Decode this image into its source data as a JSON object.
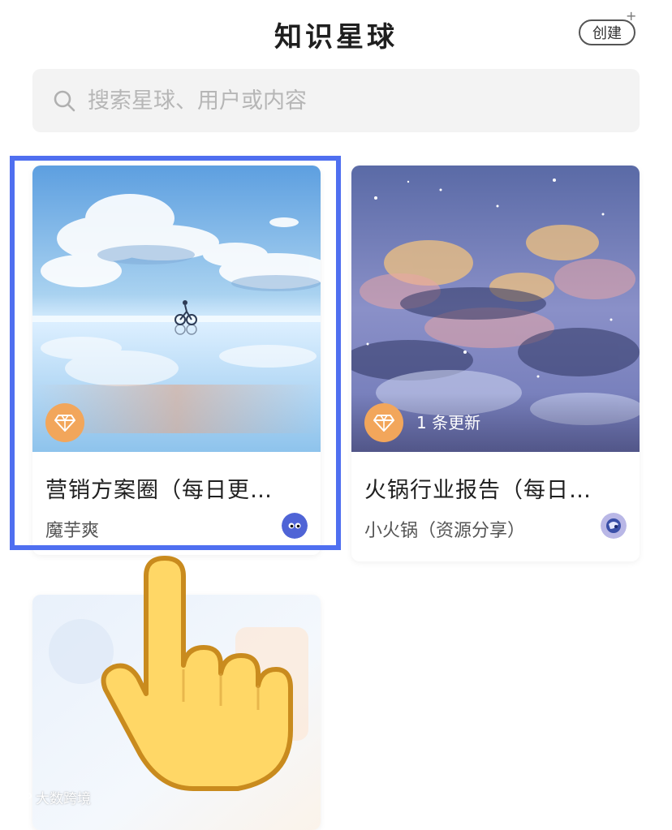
{
  "header": {
    "title": "知识星球",
    "create_label": "创建",
    "create_plus": "+"
  },
  "search": {
    "placeholder": "搜索星球、用户或内容",
    "value": ""
  },
  "cards": [
    {
      "title": "营销方案圈（每日更…",
      "owner": "魔芋爽",
      "badge_icon": "diamond-icon",
      "update_text": ""
    },
    {
      "title": "火锅行业报告（每日…",
      "owner": "小火锅（资源分享）",
      "badge_icon": "diamond-icon",
      "update_text": "1 条更新"
    }
  ],
  "overlay": {
    "highlight_color": "#4f6ff0",
    "pointer_icon": "pointing-hand-icon"
  },
  "watermark": {
    "text": "大数跨境"
  },
  "colors": {
    "badge": "#f2a65b",
    "search_bg": "#f3f3f3"
  }
}
